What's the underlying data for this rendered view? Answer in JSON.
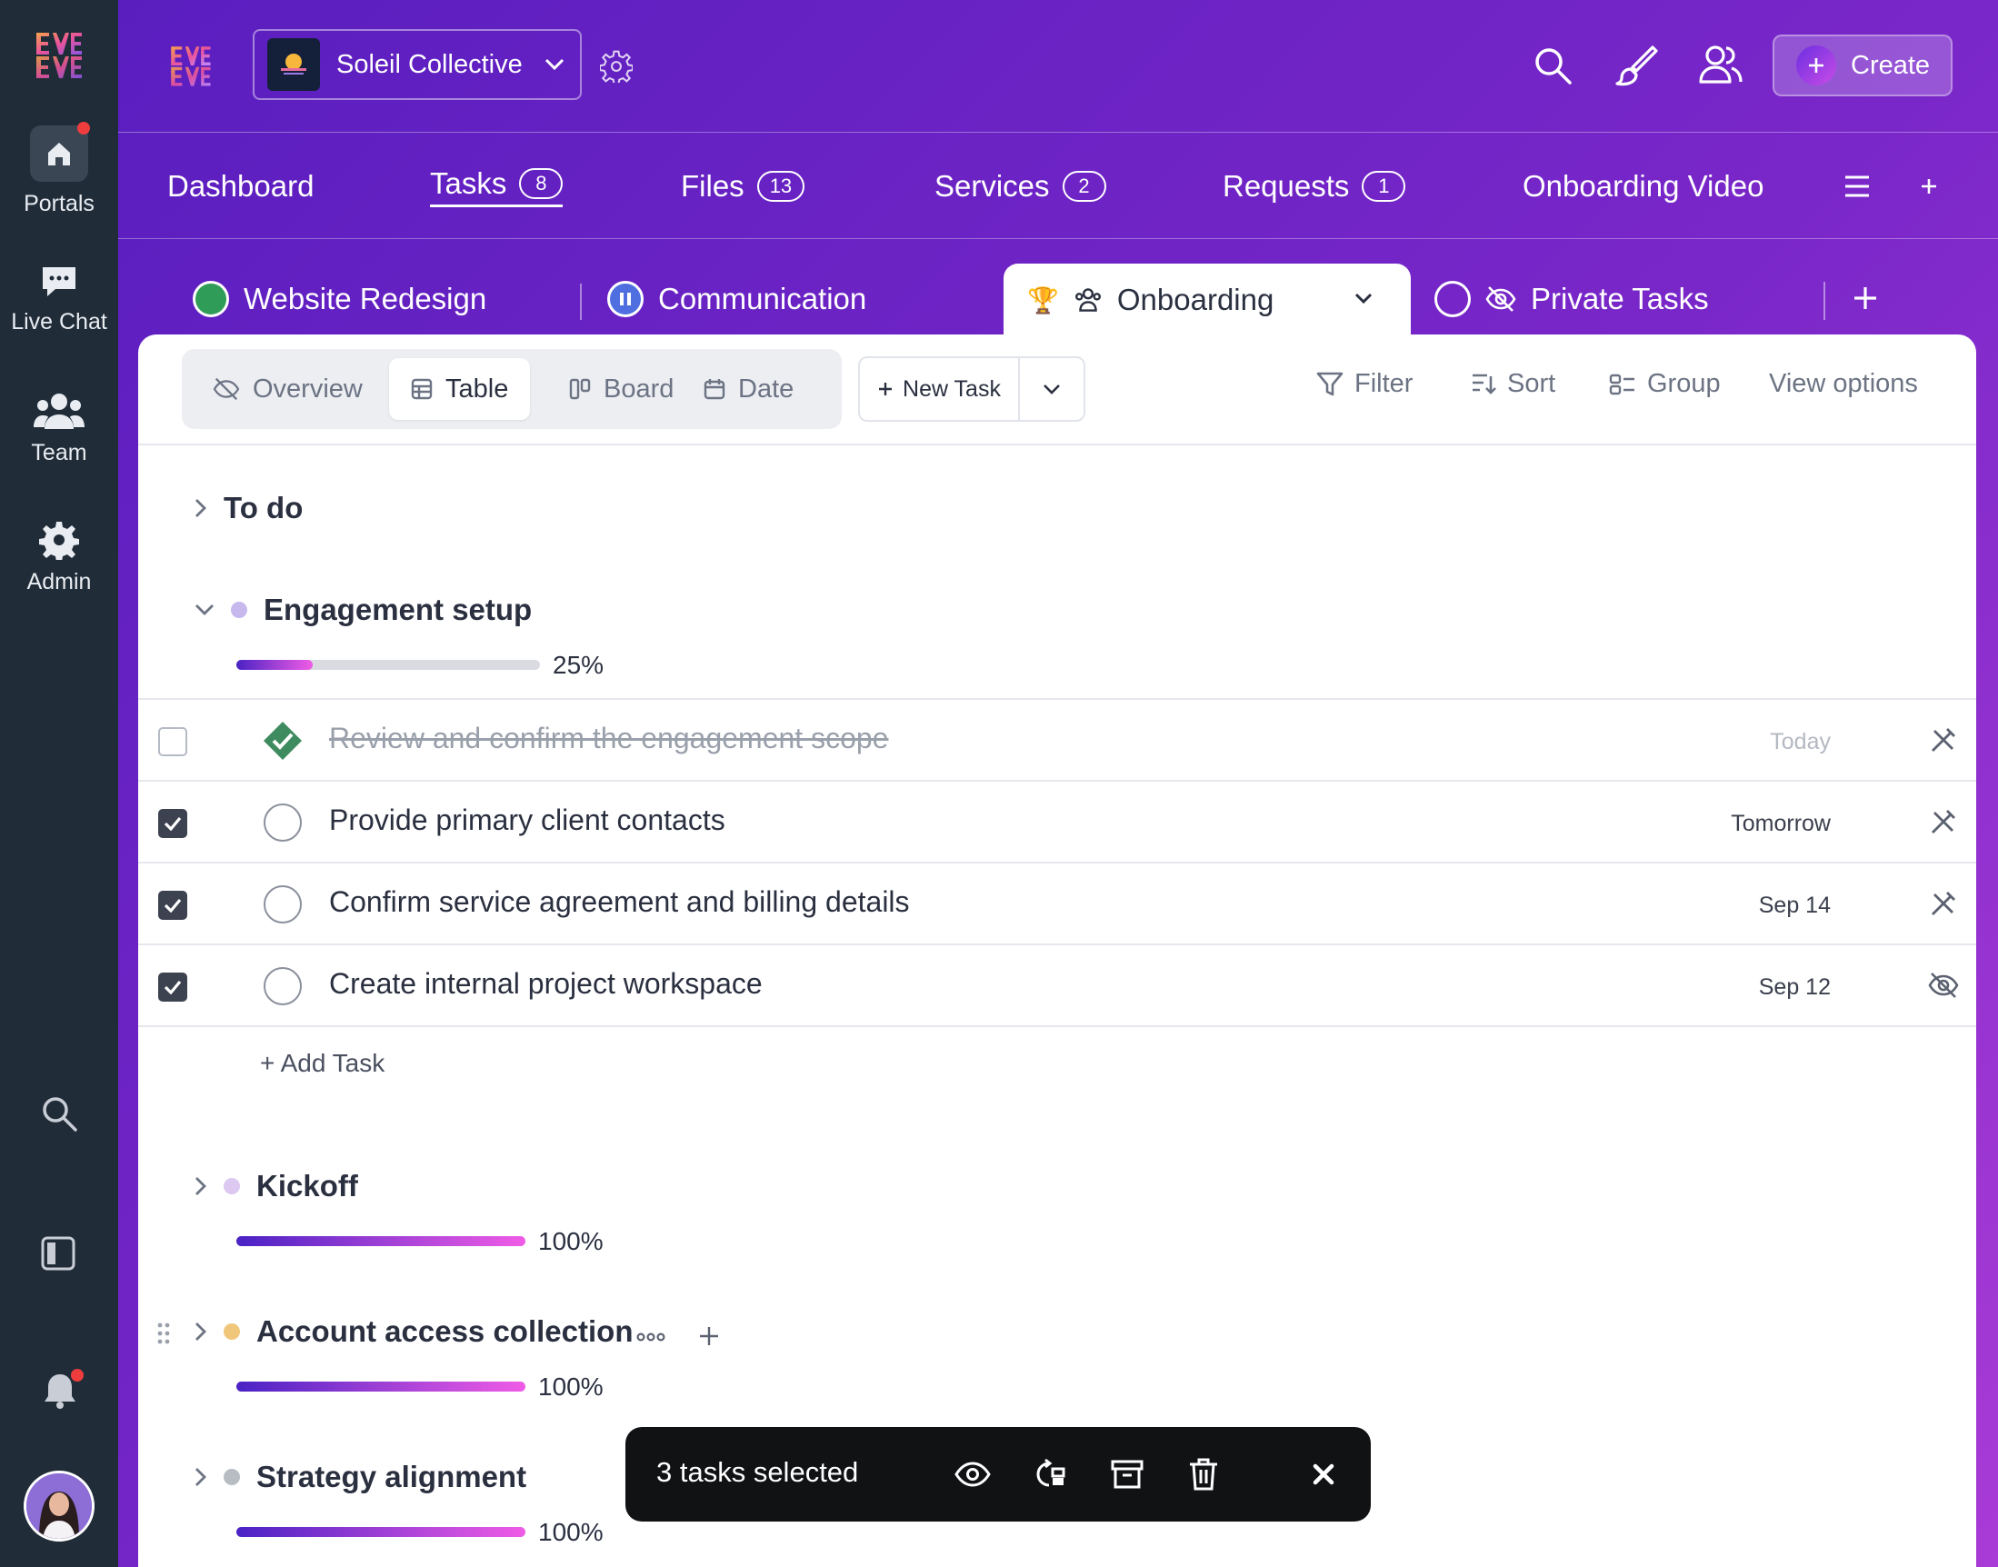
{
  "rail": {
    "items": [
      {
        "label": "Portals"
      },
      {
        "label": "Live Chat"
      },
      {
        "label": "Team"
      },
      {
        "label": "Admin"
      }
    ]
  },
  "header": {
    "workspace_name": "Soleil Collective",
    "create_label": "Create"
  },
  "nav": {
    "items": [
      {
        "label": "Dashboard",
        "count": ""
      },
      {
        "label": "Tasks",
        "count": "8"
      },
      {
        "label": "Files",
        "count": "13"
      },
      {
        "label": "Services",
        "count": "2"
      },
      {
        "label": "Requests",
        "count": "1"
      },
      {
        "label": "Onboarding Video",
        "count": ""
      }
    ]
  },
  "project_tabs": [
    {
      "label": "Website Redesign"
    },
    {
      "label": "Communication"
    },
    {
      "label": "Onboarding"
    },
    {
      "label": "Private Tasks"
    }
  ],
  "views": {
    "overview": "Overview",
    "table": "Table",
    "board": "Board",
    "date": "Date"
  },
  "toolbar": {
    "new_task": "New Task",
    "filter": "Filter",
    "sort": "Sort",
    "group": "Group",
    "view_options": "View options"
  },
  "groups": {
    "todo": {
      "title": "To do"
    },
    "engagement": {
      "title": "Engagement setup",
      "progress_label": "25%",
      "progress": 0.25,
      "dot_color": "#c7b8ee",
      "tasks": [
        {
          "title": "Review and confirm the engagement scope",
          "date": "Today",
          "checked": false,
          "done": true
        },
        {
          "title": "Provide primary client contacts",
          "date": "Tomorrow",
          "checked": true,
          "done": false
        },
        {
          "title": "Confirm service agreement and billing details",
          "date": "Sep 14",
          "checked": true,
          "done": false
        },
        {
          "title": "Create internal project workspace",
          "date": "Sep 12",
          "checked": true,
          "done": false
        }
      ],
      "add_task": "+ Add Task"
    },
    "kickoff": {
      "title": "Kickoff",
      "progress_label": "100%",
      "progress": 1.0,
      "dot_color": "#dcc8f0"
    },
    "account": {
      "title": "Account access collection",
      "progress_label": "100%",
      "progress": 1.0,
      "dot_color": "#f0c67a"
    },
    "strategy": {
      "title": "Strategy alignment",
      "progress_label": "100%",
      "progress": 1.0,
      "dot_color": "#b7bdc3"
    }
  },
  "selection": {
    "label": "3 tasks selected"
  },
  "colors": {
    "accent": "#6a22c8",
    "done_green": "#3d8b5e"
  }
}
